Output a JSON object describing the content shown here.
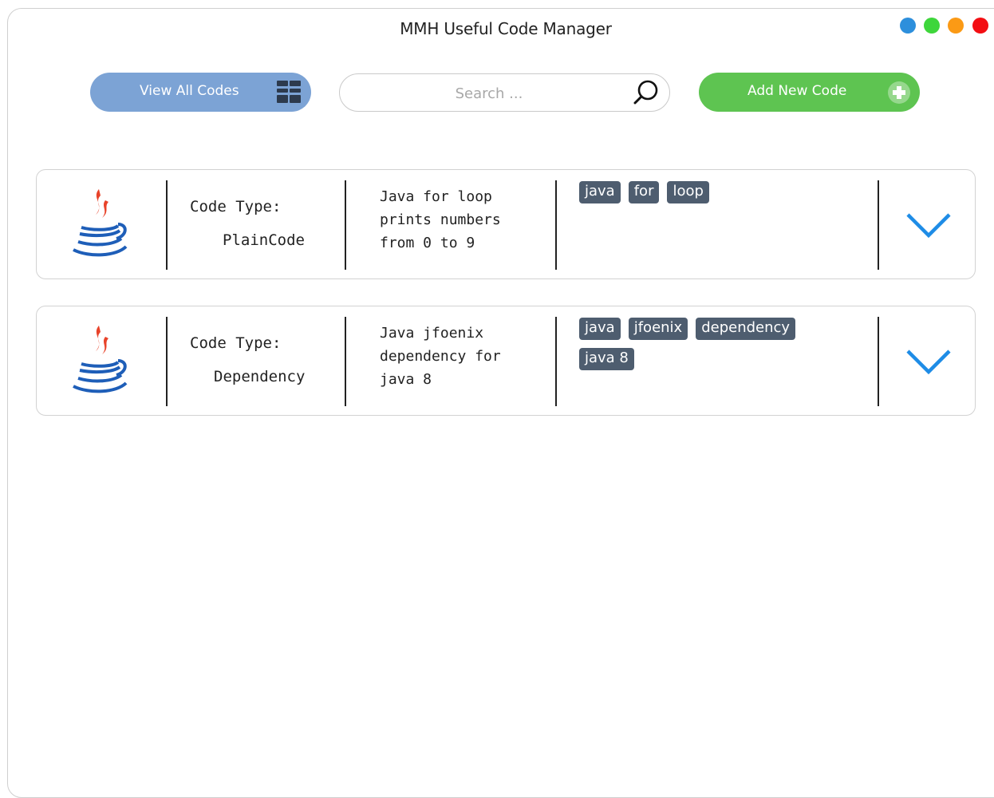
{
  "window": {
    "title": "MMH Useful Code Manager",
    "controls": [
      {
        "name": "blue-dot",
        "color": "#2d8fdc"
      },
      {
        "name": "green-dot",
        "color": "#3ed63b"
      },
      {
        "name": "orange-dot",
        "color": "#fb9a15"
      },
      {
        "name": "red-dot",
        "color": "#f30e13"
      }
    ]
  },
  "toolbar": {
    "view_all_label": "View All Codes",
    "view_all_icon": "grid-icon",
    "search_placeholder": "Search ...",
    "search_icon": "search-icon",
    "add_new_label": "Add New Code",
    "add_new_icon": "plus-icon",
    "colors": {
      "view_all": "#7ca3d5",
      "add_new": "#5ec451"
    }
  },
  "codes": [
    {
      "icon": "java-icon",
      "type_label": "Code Type:",
      "type_value": "PlainCode",
      "description": "Java for loop\nprints numbers\nfrom 0 to 9",
      "tags": [
        "java",
        "for",
        "loop"
      ],
      "expand_icon": "chevron-down-icon"
    },
    {
      "icon": "java-icon",
      "type_label": "Code Type:",
      "type_value": "Dependency",
      "description": "Java jfoenix\ndependency for\njava 8",
      "tags": [
        "java",
        "jfoenix",
        "dependency",
        "java 8"
      ],
      "expand_icon": "chevron-down-icon"
    }
  ]
}
